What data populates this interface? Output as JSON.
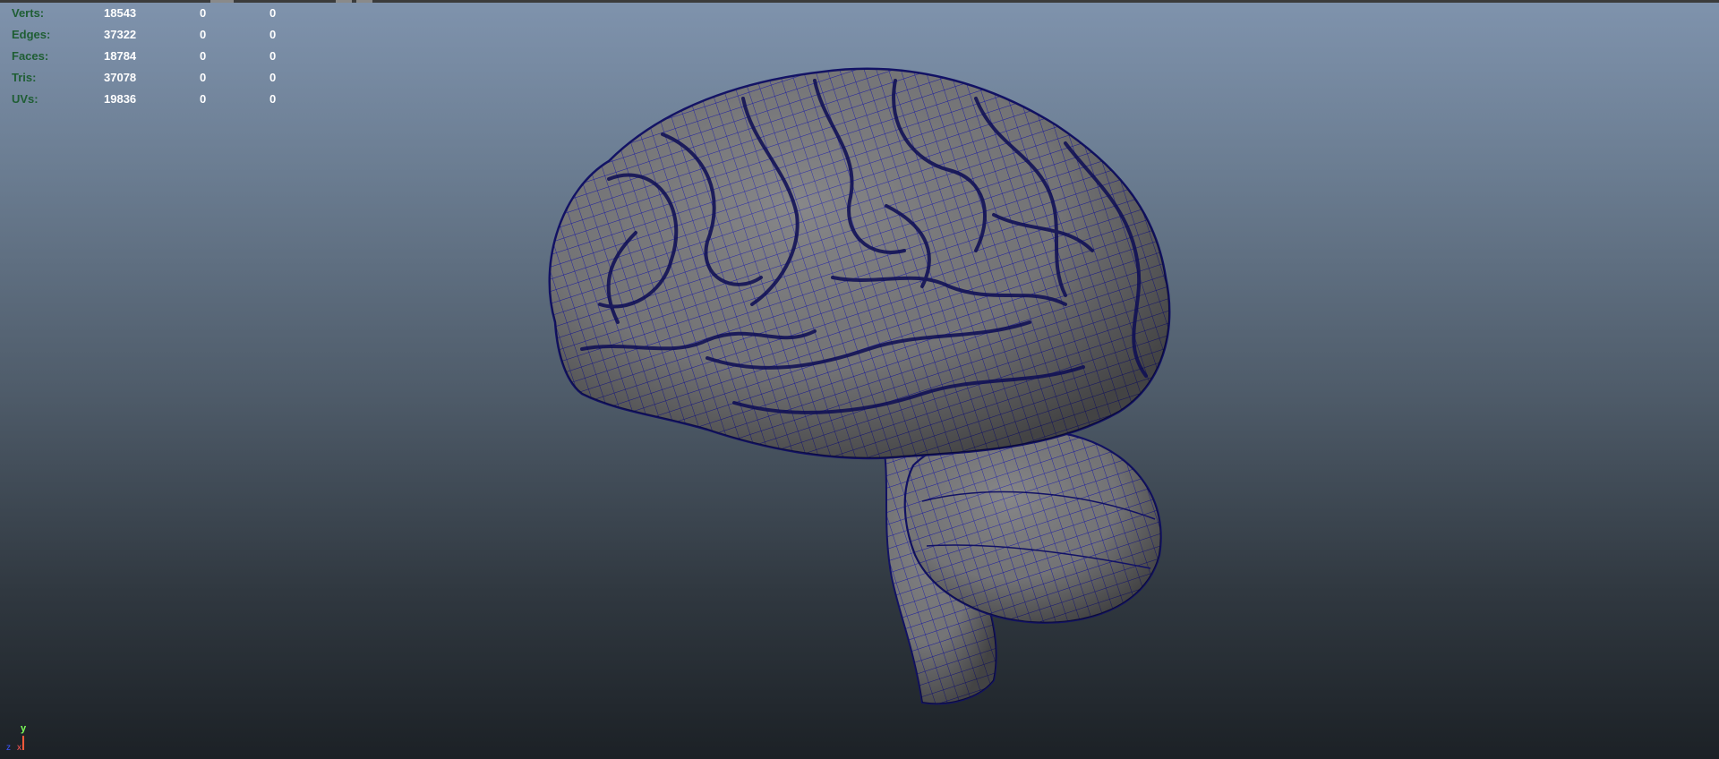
{
  "viewport": {
    "background_top": "#7f93ad",
    "background_bottom": "#1c2126",
    "wire_color": "#1a1aa8",
    "mesh_color": "#7a7a7c"
  },
  "hud": {
    "rows": [
      {
        "label": "Verts:",
        "v1": "18543",
        "v2": "0",
        "v3": "0"
      },
      {
        "label": "Edges:",
        "v1": "37322",
        "v2": "0",
        "v3": "0"
      },
      {
        "label": "Faces:",
        "v1": "18784",
        "v2": "0",
        "v3": "0"
      },
      {
        "label": "Tris:",
        "v1": "37078",
        "v2": "0",
        "v3": "0"
      },
      {
        "label": "UVs:",
        "v1": "19836",
        "v2": "0",
        "v3": "0"
      }
    ]
  },
  "axis": {
    "y": "y",
    "x": "x",
    "z": "z"
  }
}
